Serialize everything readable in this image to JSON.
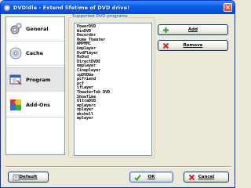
{
  "window": {
    "title": "DVDIdle - Extend lifetime of DVD drive!"
  },
  "sidebar": {
    "items": [
      {
        "label": "General",
        "icon": "gear-icon"
      },
      {
        "label": "Cache",
        "icon": "disc-icon"
      },
      {
        "label": "Program",
        "icon": "program-window-icon"
      },
      {
        "label": "Add-Ons",
        "icon": "puzzle-icon"
      }
    ],
    "active_index": 2
  },
  "programs": {
    "group_label": "Supported DVD programs",
    "items": [
      "PowerDVD",
      "WinDVD",
      "Recorder",
      "Home Theater",
      "WMPMMC",
      "kmplayer",
      "DvdPlayer",
      "MsDvd",
      "DirectDVDE",
      "mmplayer",
      "Cineplayer",
      "zpDVDba",
      "pcfriend",
      "pcf",
      "ifLayer",
      "TheaterTek DVD",
      "ShowTime",
      "UltraDVD",
      "mplayerc",
      "zplayer",
      "mkshell",
      "mplayer"
    ]
  },
  "buttons": {
    "add": "Add",
    "remove": "Remove",
    "default": "Default",
    "ok": "OK",
    "cancel": "Cancel"
  },
  "colors": {
    "title_bar": "#0a5ce8",
    "group_label": "#0046d5",
    "add_icon": "#2a9a2a",
    "remove_icon": "#d02020"
  }
}
